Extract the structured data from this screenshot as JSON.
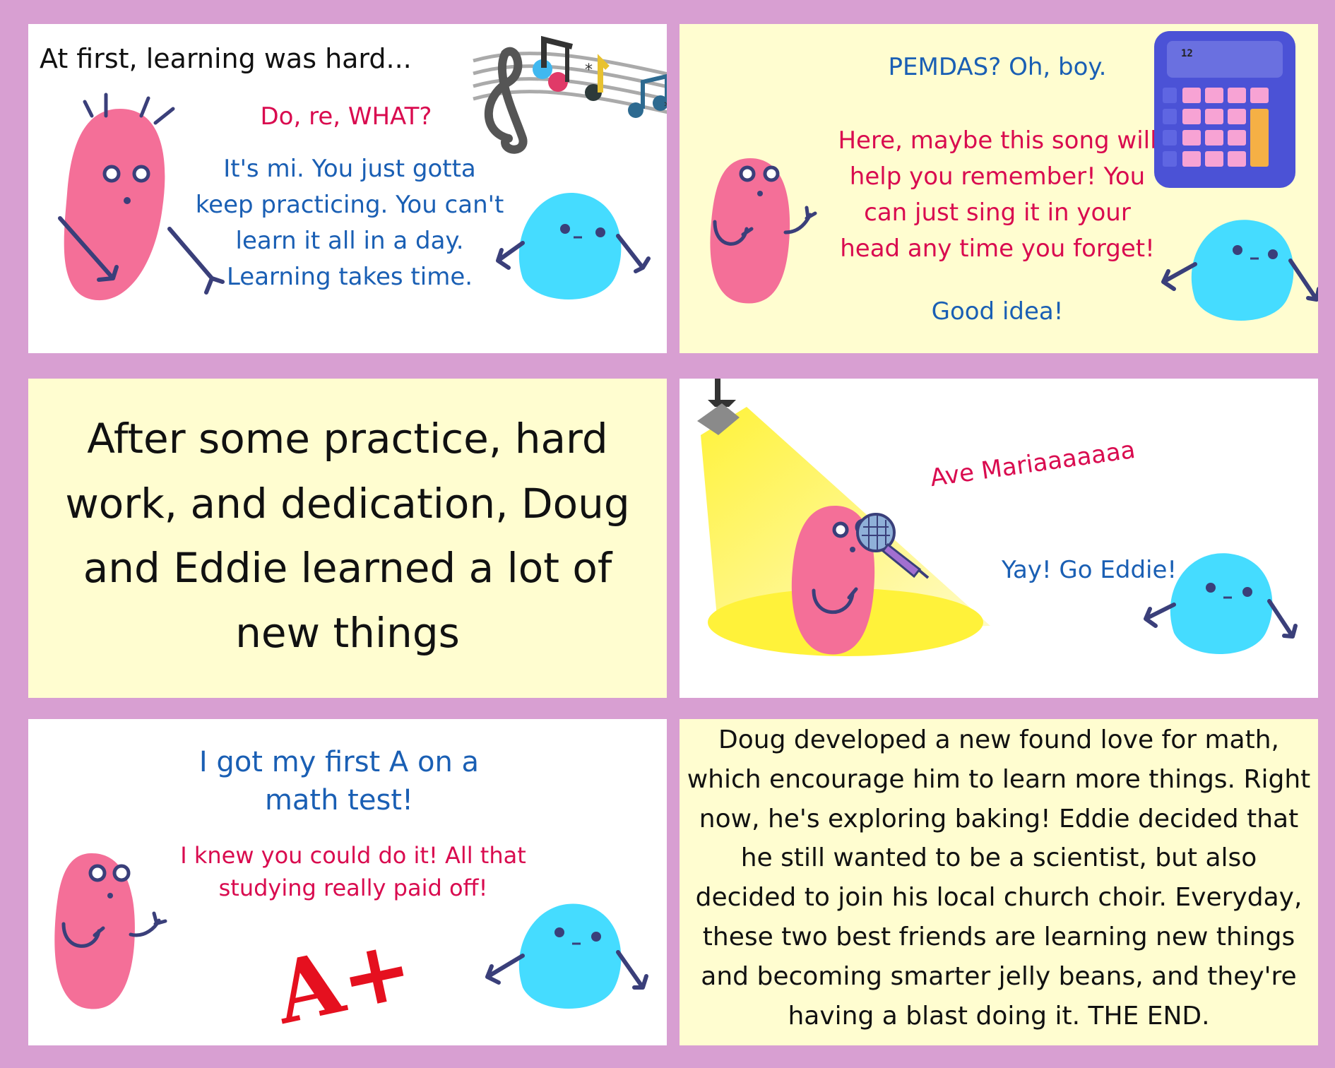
{
  "panels": {
    "p1": {
      "caption": "At first, learning was hard...",
      "doug_line": "Do, re, WHAT?",
      "eddie_line": "It's mi. You just gotta keep practicing. You can't learn it all in a day. Learning takes time."
    },
    "p2": {
      "doug_line": "PEMDAS? Oh, boy.",
      "eddie_line": "Here, maybe this song will help you remember!  You can just sing it in your head any time you forget!",
      "doug_reply": "Good idea!",
      "calculator_display": "12"
    },
    "p3": {
      "caption": "After some practice, hard work, and dedication, Doug and Eddie learned a lot of new things"
    },
    "p4": {
      "eddie_line": "Ave Mariaaaaaaa",
      "doug_line": "Yay! Go Eddie!"
    },
    "p5": {
      "doug_line": "I got my first A on a math test!",
      "eddie_line": "I knew you could do it! All that studying really paid off!",
      "grade": "A+"
    },
    "p6": {
      "caption": "Doug developed a new found love for math, which encourage him to learn more things. Right now, he's exploring baking! Eddie decided that he still wanted to be a scientist, but also decided to join his local church choir. Everyday, these two best friends are learning new things and becoming smarter jelly beans, and they're having a blast doing it. THE END."
    }
  },
  "colors": {
    "background": "#d89fd2",
    "white_panel": "#ffffff",
    "cream_panel": "#fffdd0",
    "pink_bean": "#f46f98",
    "blue_bean": "#45dcff",
    "blue_text": "#1a5fb4",
    "red_text": "#d90b4f",
    "spotlight": "#fff23a"
  }
}
